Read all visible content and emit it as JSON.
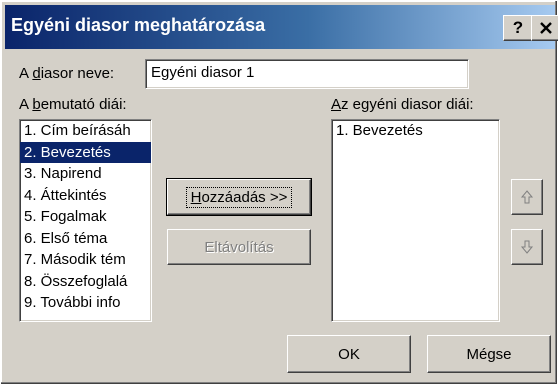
{
  "window": {
    "title": "Egyéni diasor meghatározása",
    "help_label": "?",
    "close_label": "✕"
  },
  "name_field": {
    "label_prefix": "A ",
    "label_access": "d",
    "label_rest": "iasor neve:",
    "value": "Egyéni diasor 1"
  },
  "left_list": {
    "label_prefix": "A ",
    "label_access": "b",
    "label_rest": "emutató diái:",
    "items": [
      "1. Cím beírásáh",
      "2. Bevezetés",
      "3. Napirend",
      "4. Áttekintés",
      "5. Fogalmak",
      "6. Első téma",
      "7. Második tém",
      "8. Összefoglalá",
      "9. További info"
    ],
    "selected_index": 1
  },
  "right_list": {
    "label_access": "A",
    "label_rest": "z egyéni diasor diái:",
    "items": [
      "1. Bevezetés"
    ]
  },
  "buttons": {
    "add_access": "H",
    "add_rest": "ozzáadás >>",
    "remove_label": "Eltávolítás",
    "ok_label": "OK",
    "cancel_label": "Mégse"
  },
  "icons": {
    "move_up": "arrow-up-icon",
    "move_down": "arrow-down-icon"
  },
  "colors": {
    "title_bar_start": "#0a246a",
    "title_bar_end": "#a6caf0",
    "selection": "#0a246a",
    "face": "#d4d0c8"
  }
}
